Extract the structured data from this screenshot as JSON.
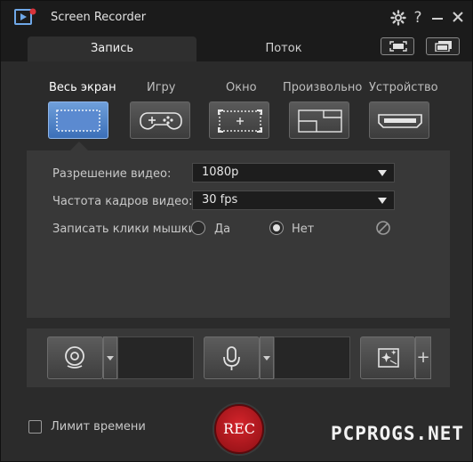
{
  "app": {
    "title": "Screen Recorder"
  },
  "titlebar": {
    "settings_icon": "gear-icon",
    "help_label": "?",
    "minimize_icon": "minimize-icon",
    "close_icon": "close-icon"
  },
  "tabs": [
    {
      "label": "Запись",
      "active": true
    },
    {
      "label": "Поток",
      "active": false
    }
  ],
  "view_buttons": [
    "fullscreen-view-icon",
    "compact-view-icon"
  ],
  "modes": [
    {
      "label": "Весь экран",
      "icon": "fullscreen-mode-icon",
      "active": true
    },
    {
      "label": "Игру",
      "icon": "gamepad-icon",
      "active": false
    },
    {
      "label": "Окно",
      "icon": "window-mode-icon",
      "active": false
    },
    {
      "label": "Произвольно",
      "icon": "custom-region-icon",
      "active": false
    },
    {
      "label": "Устройство",
      "icon": "hdmi-device-icon",
      "active": false
    }
  ],
  "settings": {
    "resolution_label": "Разрешение видео:",
    "resolution_value": "1080p",
    "framerate_label": "Частота кадров видео:",
    "framerate_value": "30 fps",
    "clicks_label": "Записать клики мышки:",
    "clicks_yes": "Да",
    "clicks_no": "Нет",
    "clicks_selected": "Нет"
  },
  "controls": {
    "webcam_icon": "webcam-icon",
    "mic_icon": "microphone-icon",
    "effects_icon": "effects-sparkle-icon",
    "add_label": "+"
  },
  "footer": {
    "time_limit_label": "Лимит времени",
    "time_limit_checked": false,
    "rec_label": "REC",
    "watermark": "PCPROGS.NET"
  },
  "colors": {
    "accent": "#4a7fc6",
    "rec": "#c81f26",
    "background": "#2b2b2b"
  }
}
